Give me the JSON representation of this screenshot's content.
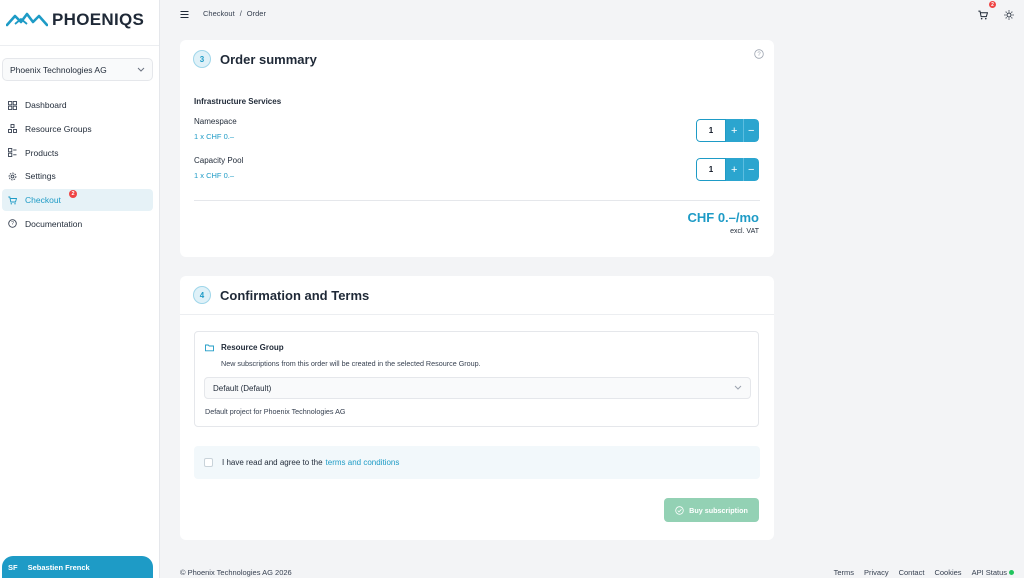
{
  "app": {
    "brand": "PHOENIQS",
    "brand_color": "#1e9bc6"
  },
  "sidebar": {
    "org_selector": "Phoenix Technologies AG",
    "items": [
      {
        "label": "Dashboard",
        "icon": "dashboard-icon"
      },
      {
        "label": "Resource Groups",
        "icon": "resource-groups-icon"
      },
      {
        "label": "Products",
        "icon": "products-icon"
      },
      {
        "label": "Settings",
        "icon": "gear-icon"
      },
      {
        "label": "Checkout",
        "icon": "cart-icon",
        "active": true,
        "badge": "2"
      },
      {
        "label": "Documentation",
        "icon": "documentation-icon"
      }
    ],
    "user": {
      "initials": "SF",
      "name": "Sebastien Frenck"
    }
  },
  "topbar": {
    "breadcrumb": [
      "Checkout",
      "/",
      "Order"
    ],
    "cart_badge": "2"
  },
  "order_summary": {
    "step": "3",
    "title": "Order summary",
    "section": "Infrastructure Services",
    "items": [
      {
        "name": "Namespace",
        "price": "1 x CHF 0.–",
        "quantity": "1"
      },
      {
        "name": "Capacity Pool",
        "price": "1 x CHF 0.–",
        "quantity": "1"
      }
    ],
    "plus": "+",
    "minus": "−",
    "total": "CHF 0.–/mo",
    "total_note": "excl. VAT"
  },
  "confirmation": {
    "step": "4",
    "title": "Confirmation and Terms",
    "resource_group": {
      "title": "Resource Group",
      "description": "New subscriptions from this order will be created in the selected Resource Group.",
      "selected": "Default (Default)",
      "hint": "Default project for Phoenix Technologies AG"
    },
    "terms_prefix": "I have read and agree to the",
    "terms_link": "terms and conditions",
    "buy_button": "Buy subscription"
  },
  "footer": {
    "copyright": "© Phoenix Technologies AG 2026",
    "links": [
      "Terms",
      "Privacy",
      "Contact",
      "Cookies",
      "API Status"
    ],
    "api_status_color": "#22c55e"
  }
}
